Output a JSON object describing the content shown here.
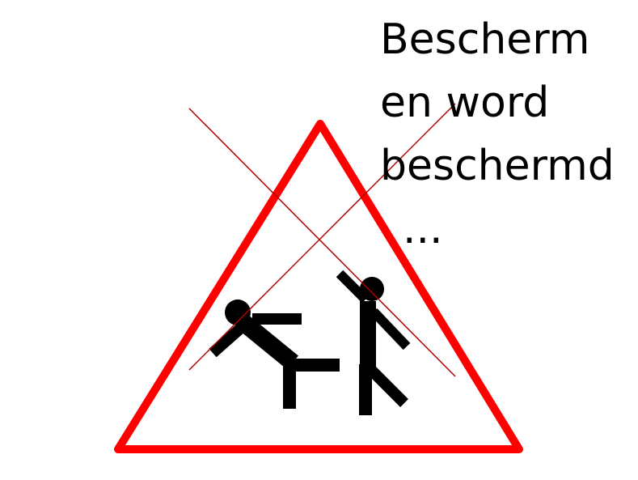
{
  "slogan": {
    "line1": "Bescherm",
    "line2": "en word",
    "line3": "beschermd",
    "line4": "..."
  },
  "colors": {
    "background": "#ffffff",
    "sign_border": "#ff0000",
    "cross_lines": "#b00000",
    "figures": "#000000",
    "text": "#000000"
  },
  "icons": {
    "sign": "warning-triangle-icon",
    "figure_left": "falling-figure-icon",
    "figure_right": "kicking-figure-icon",
    "cross": "cross-out-icon"
  }
}
